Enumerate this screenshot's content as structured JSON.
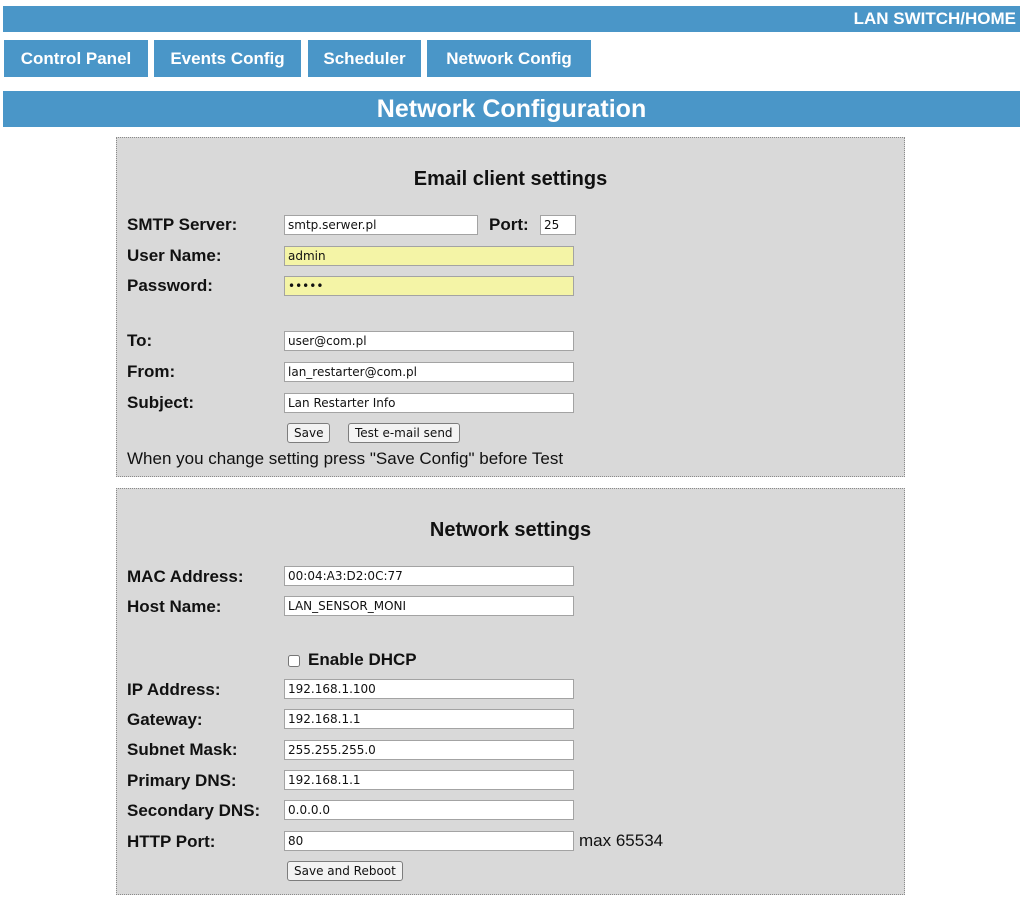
{
  "header": {
    "title": "LAN SWITCH/HOME"
  },
  "tabs": [
    {
      "label": "Control Panel"
    },
    {
      "label": "Events Config"
    },
    {
      "label": "Scheduler"
    },
    {
      "label": "Network Config"
    }
  ],
  "page_title": "Network Configuration",
  "email": {
    "title": "Email client settings",
    "smtp_label": "SMTP Server:",
    "smtp_value": "smtp.serwer.pl",
    "port_label": "Port:",
    "port_value": "25",
    "user_label": "User Name:",
    "user_value": "admin",
    "password_label": "Password:",
    "password_value": "•••••",
    "to_label": "To:",
    "to_value": "user@com.pl",
    "from_label": "From:",
    "from_value": "lan_restarter@com.pl",
    "subject_label": "Subject:",
    "subject_value": "Lan Restarter Info",
    "save_label": "Save",
    "test_label": "Test e-mail send",
    "note": "When you change setting press \"Save Config\" before Test"
  },
  "network": {
    "title": "Network settings",
    "mac_label": "MAC Address:",
    "mac_value": "00:04:A3:D2:0C:77",
    "host_label": "Host Name:",
    "host_value": "LAN_SENSOR_MONI",
    "dhcp_label": "Enable DHCP",
    "dhcp_checked": false,
    "ip_label": "IP Address:",
    "ip_value": "192.168.1.100",
    "gateway_label": "Gateway:",
    "gateway_value": "192.168.1.1",
    "subnet_label": "Subnet Mask:",
    "subnet_value": "255.255.255.0",
    "dns1_label": "Primary DNS:",
    "dns1_value": "192.168.1.1",
    "dns2_label": "Secondary DNS:",
    "dns2_value": "0.0.0.0",
    "http_label": "HTTP Port:",
    "http_value": "80",
    "http_max": "max 65534",
    "reboot_label": "Save and Reboot"
  },
  "colors": {
    "accent": "#4a96c8",
    "panel_bg": "#d9d9d9",
    "highlight_input": "#f4f4a6"
  }
}
